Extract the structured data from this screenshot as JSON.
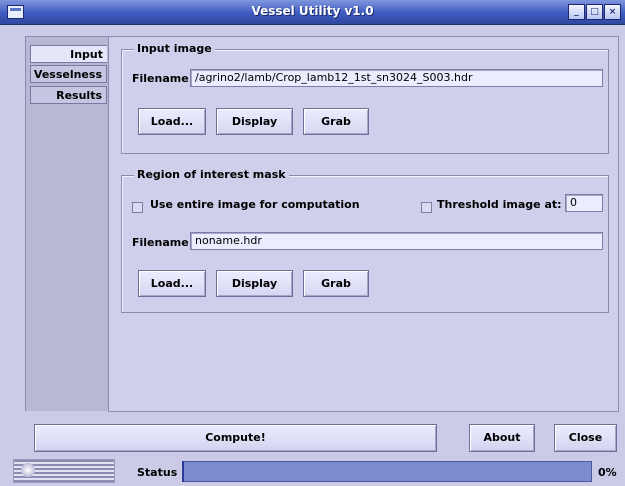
{
  "window": {
    "title": "Vessel Utility v1.0"
  },
  "tabs": [
    {
      "label": "Input",
      "selected": true
    },
    {
      "label": "Vesselness",
      "selected": false
    },
    {
      "label": "Results",
      "selected": false
    }
  ],
  "input_image": {
    "legend": "Input image",
    "filename_label": "Filename:",
    "filename_value": "/agrino2/lamb/Crop_lamb12_1st_sn3024_S003.hdr",
    "buttons": {
      "load": "Load...",
      "display": "Display",
      "grab": "Grab"
    }
  },
  "roi_mask": {
    "legend": "Region of interest mask",
    "use_entire_label": "Use entire image for computation",
    "use_entire_checked": false,
    "threshold_label": "Threshold image at:",
    "threshold_checked": false,
    "threshold_value": "0",
    "filename_label": "Filename:",
    "filename_value": "noname.hdr",
    "buttons": {
      "load": "Load...",
      "display": "Display",
      "grab": "Grab"
    }
  },
  "footer": {
    "compute": "Compute!",
    "about": "About",
    "close": "Close",
    "status_label": "Status",
    "progress_percent": "0%",
    "progress_fraction": 0
  },
  "colors": {
    "title_bar": "#3e5bc0",
    "window_bg": "#cbcbe8",
    "progress_bar": "#7c8ad0"
  }
}
